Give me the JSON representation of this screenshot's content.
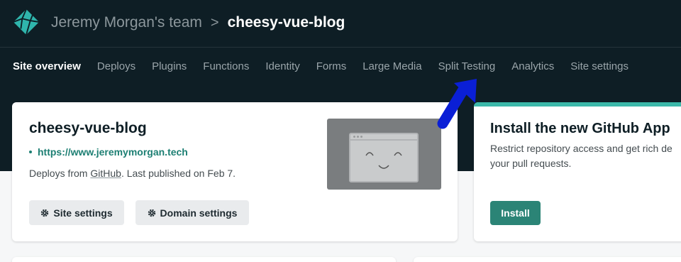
{
  "header": {
    "logo_icon": "netlify-logo-icon",
    "team": "Jeremy Morgan's team",
    "separator": ">",
    "site": "cheesy-vue-blog"
  },
  "nav": {
    "tabs": [
      {
        "label": "Site overview",
        "active": true
      },
      {
        "label": "Deploys"
      },
      {
        "label": "Plugins"
      },
      {
        "label": "Functions"
      },
      {
        "label": "Identity"
      },
      {
        "label": "Forms"
      },
      {
        "label": "Large Media"
      },
      {
        "label": "Split Testing"
      },
      {
        "label": "Analytics"
      },
      {
        "label": "Site settings"
      }
    ]
  },
  "site_card": {
    "title": "cheesy-vue-blog",
    "url": "https://www.jeremymorgan.tech",
    "deploy_prefix": "Deploys from ",
    "deploy_source": "GitHub",
    "deploy_suffix": ". Last published on Feb 7.",
    "site_settings_label": "Site settings",
    "domain_settings_label": "Domain settings",
    "preview_icon": "smiley-window-icon"
  },
  "github_card": {
    "title": "Install the new GitHub App",
    "desc_line1": "Restrict repository access and get rich de",
    "desc_line2": "your pull requests.",
    "install_label": "Install"
  },
  "colors": {
    "topbar": "#0e1e25",
    "accent": "#3bb8a9",
    "link": "#1d7f73",
    "install_button": "#2b8476",
    "annotation_arrow": "#0a1fd6"
  },
  "annotation": {
    "icon": "pointer-arrow-icon"
  }
}
